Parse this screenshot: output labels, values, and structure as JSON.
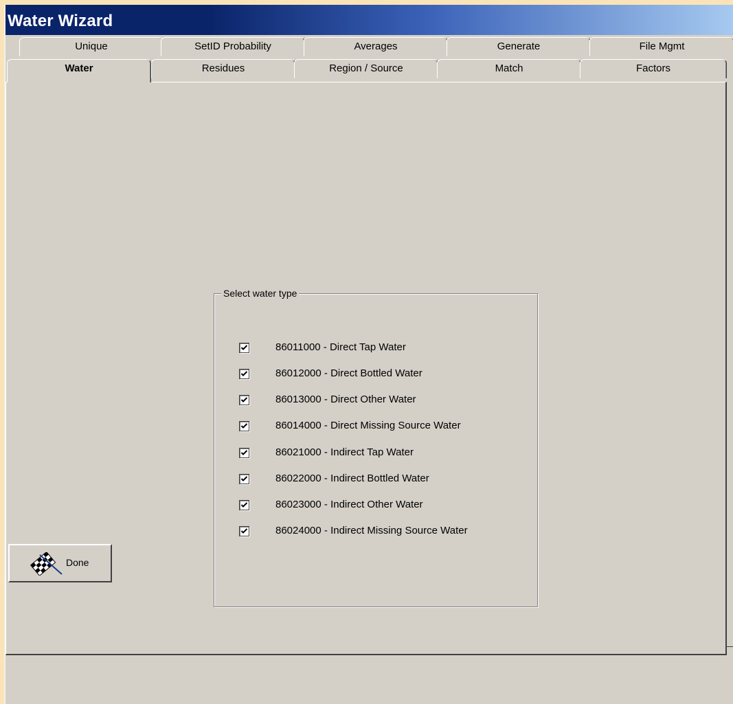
{
  "window": {
    "title": "Water Wizard"
  },
  "tabs": {
    "row1": [
      "Unique",
      "SetID Probability",
      "Averages",
      "Generate",
      "File Mgmt"
    ],
    "row2": [
      "Water",
      "Residues",
      "Region / Source",
      "Match",
      "Factors"
    ],
    "active": "Water"
  },
  "group": {
    "legend": "Select water type",
    "items": [
      {
        "label": "86011000 - Direct Tap Water",
        "checked": true
      },
      {
        "label": "86012000 - Direct Bottled Water",
        "checked": true
      },
      {
        "label": "86013000 - Direct Other Water",
        "checked": true
      },
      {
        "label": "86014000 - Direct Missing Source Water",
        "checked": true
      },
      {
        "label": "86021000 - Indirect Tap Water",
        "checked": true
      },
      {
        "label": "86022000 - Indirect Bottled Water",
        "checked": true
      },
      {
        "label": "86023000 - Indirect Other Water",
        "checked": true
      },
      {
        "label": "86024000 - Indirect Missing Source Water",
        "checked": true
      }
    ]
  },
  "footer": {
    "done_label": "Done",
    "done_icon": "checkered-flag-icon"
  },
  "colors": {
    "face": "#d4d0c8",
    "title_start": "#0a246a",
    "title_end": "#a6caf0",
    "desktop": "#fbe3b8"
  }
}
